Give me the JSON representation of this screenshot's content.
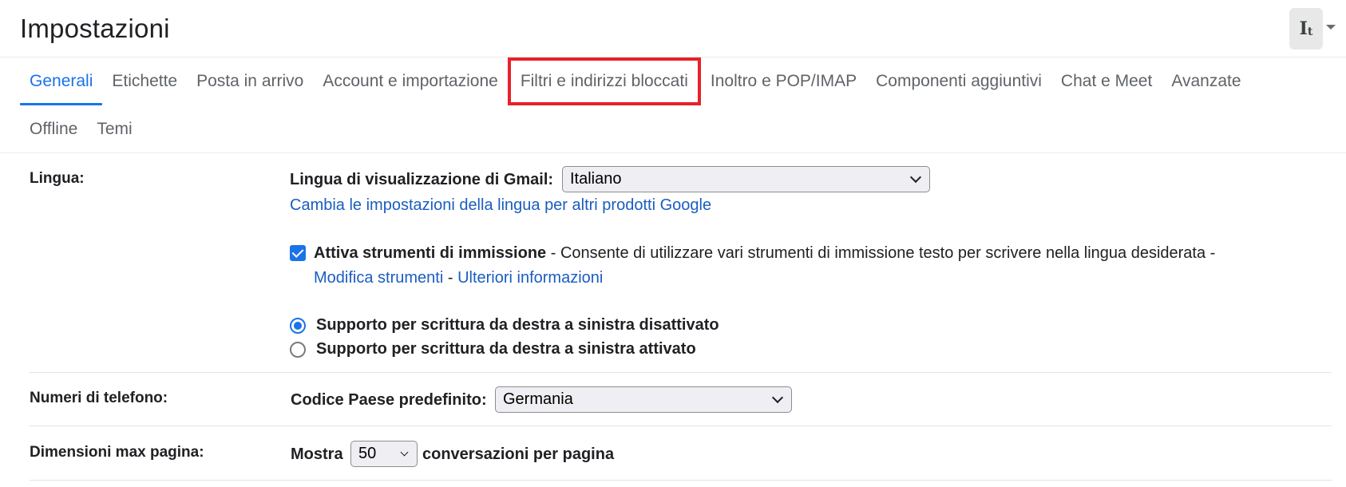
{
  "header": {
    "title": "Impostazioni",
    "input_tools_icon": "It",
    "input_tools_icon_sub": "t"
  },
  "tabs": {
    "row1": [
      {
        "label": "Generali",
        "active": true
      },
      {
        "label": "Etichette"
      },
      {
        "label": "Posta in arrivo"
      },
      {
        "label": "Account e importazione"
      },
      {
        "label": "Filtri e indirizzi bloccati",
        "highlighted": true
      },
      {
        "label": "Inoltro e POP/IMAP"
      },
      {
        "label": "Componenti aggiuntivi"
      },
      {
        "label": "Chat e Meet"
      },
      {
        "label": "Avanzate"
      }
    ],
    "row2": [
      {
        "label": "Offline"
      },
      {
        "label": "Temi"
      }
    ]
  },
  "settings": {
    "language": {
      "label": "Lingua:",
      "display_language_label": "Lingua di visualizzazione di Gmail:",
      "display_language_value": "Italiano",
      "change_link": "Cambia le impostazioni della lingua per altri prodotti Google",
      "input_tools_checked": true,
      "input_tools_title": "Attiva strumenti di immissione",
      "input_tools_desc": " - Consente di utilizzare vari strumenti di immissione testo per scrivere nella lingua desiderata -",
      "edit_tools_link": "Modifica strumenti",
      "separator": " - ",
      "more_info_link": "Ulteriori informazioni",
      "rtl_off_label": "Supporto per scrittura da destra a sinistra disattivato",
      "rtl_on_label": "Supporto per scrittura da destra a sinistra attivato",
      "rtl_selected": "off"
    },
    "phone": {
      "label": "Numeri di telefono:",
      "country_code_label": "Codice Paese predefinito:",
      "country_code_value": "Germania"
    },
    "page_size": {
      "label": "Dimensioni max pagina:",
      "show_label": "Mostra",
      "value": "50",
      "suffix": "conversazioni per pagina"
    }
  },
  "colors": {
    "accent": "#1a73e8",
    "highlight_box": "#e8202a",
    "link": "#1a5dc0"
  }
}
